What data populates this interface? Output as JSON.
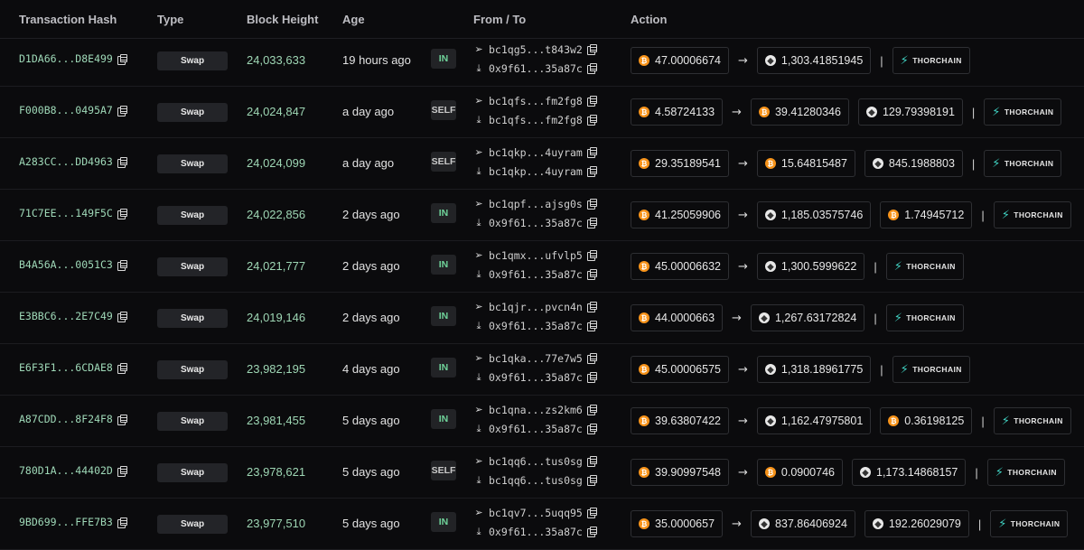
{
  "headers": {
    "hash": "Transaction Hash",
    "type": "Type",
    "block": "Block Height",
    "age": "Age",
    "fromto": "From / To",
    "action": "Action"
  },
  "rows": [
    {
      "hash": "D1DA66...D8E499",
      "type": "Swap",
      "block": "24,033,633",
      "age": "19 hours ago",
      "dir": "IN",
      "from": "bc1qg5...t843w2",
      "to": "0x9f61...35a87c",
      "action": [
        {
          "kind": "asset",
          "coin": "btc",
          "amount": "47.00006674"
        },
        {
          "kind": "arrow"
        },
        {
          "kind": "asset",
          "coin": "eth",
          "amount": "1,303.41851945"
        },
        {
          "kind": "sep"
        },
        {
          "kind": "thor",
          "label": "THORCHAIN"
        }
      ]
    },
    {
      "hash": "F000B8...0495A7",
      "type": "Swap",
      "block": "24,024,847",
      "age": "a day ago",
      "dir": "SELF",
      "from": "bc1qfs...fm2fg8",
      "to": "bc1qfs...fm2fg8",
      "action": [
        {
          "kind": "asset",
          "coin": "btc",
          "amount": "4.58724133"
        },
        {
          "kind": "arrow"
        },
        {
          "kind": "asset",
          "coin": "btc",
          "amount": "39.41280346"
        },
        {
          "kind": "asset",
          "coin": "eth",
          "amount": "129.79398191"
        },
        {
          "kind": "sep"
        },
        {
          "kind": "thor",
          "label": "THORCHAIN"
        }
      ]
    },
    {
      "hash": "A283CC...DD4963",
      "type": "Swap",
      "block": "24,024,099",
      "age": "a day ago",
      "dir": "SELF",
      "from": "bc1qkp...4uyram",
      "to": "bc1qkp...4uyram",
      "action": [
        {
          "kind": "asset",
          "coin": "btc",
          "amount": "29.35189541"
        },
        {
          "kind": "arrow"
        },
        {
          "kind": "asset",
          "coin": "btc",
          "amount": "15.64815487"
        },
        {
          "kind": "asset",
          "coin": "eth",
          "amount": "845.1988803"
        },
        {
          "kind": "sep"
        },
        {
          "kind": "thor",
          "label": "THORCHAIN"
        }
      ]
    },
    {
      "hash": "71C7EE...149F5C",
      "type": "Swap",
      "block": "24,022,856",
      "age": "2 days ago",
      "dir": "IN",
      "from": "bc1qpf...ajsg0s",
      "to": "0x9f61...35a87c",
      "action": [
        {
          "kind": "asset",
          "coin": "btc",
          "amount": "41.25059906"
        },
        {
          "kind": "arrow"
        },
        {
          "kind": "asset",
          "coin": "eth",
          "amount": "1,185.03575746"
        },
        {
          "kind": "asset",
          "coin": "btc",
          "amount": "1.74945712"
        },
        {
          "kind": "sep"
        },
        {
          "kind": "thor",
          "label": "THORCHAIN"
        }
      ]
    },
    {
      "hash": "B4A56A...0051C3",
      "type": "Swap",
      "block": "24,021,777",
      "age": "2 days ago",
      "dir": "IN",
      "from": "bc1qmx...ufvlp5",
      "to": "0x9f61...35a87c",
      "action": [
        {
          "kind": "asset",
          "coin": "btc",
          "amount": "45.00006632"
        },
        {
          "kind": "arrow"
        },
        {
          "kind": "asset",
          "coin": "eth",
          "amount": "1,300.5999622"
        },
        {
          "kind": "sep"
        },
        {
          "kind": "thor",
          "label": "THORCHAIN"
        }
      ]
    },
    {
      "hash": "E3BBC6...2E7C49",
      "type": "Swap",
      "block": "24,019,146",
      "age": "2 days ago",
      "dir": "IN",
      "from": "bc1qjr...pvcn4n",
      "to": "0x9f61...35a87c",
      "action": [
        {
          "kind": "asset",
          "coin": "btc",
          "amount": "44.0000663"
        },
        {
          "kind": "arrow"
        },
        {
          "kind": "asset",
          "coin": "eth",
          "amount": "1,267.63172824"
        },
        {
          "kind": "sep"
        },
        {
          "kind": "thor",
          "label": "THORCHAIN"
        }
      ]
    },
    {
      "hash": "E6F3F1...6CDAE8",
      "type": "Swap",
      "block": "23,982,195",
      "age": "4 days ago",
      "dir": "IN",
      "from": "bc1qka...77e7w5",
      "to": "0x9f61...35a87c",
      "action": [
        {
          "kind": "asset",
          "coin": "btc",
          "amount": "45.00006575"
        },
        {
          "kind": "arrow"
        },
        {
          "kind": "asset",
          "coin": "eth",
          "amount": "1,318.18961775"
        },
        {
          "kind": "sep"
        },
        {
          "kind": "thor",
          "label": "THORCHAIN"
        }
      ]
    },
    {
      "hash": "A87CDD...8F24F8",
      "type": "Swap",
      "block": "23,981,455",
      "age": "5 days ago",
      "dir": "IN",
      "from": "bc1qna...zs2km6",
      "to": "0x9f61...35a87c",
      "action": [
        {
          "kind": "asset",
          "coin": "btc",
          "amount": "39.63807422"
        },
        {
          "kind": "arrow"
        },
        {
          "kind": "asset",
          "coin": "eth",
          "amount": "1,162.47975801"
        },
        {
          "kind": "asset",
          "coin": "btc",
          "amount": "0.36198125"
        },
        {
          "kind": "sep"
        },
        {
          "kind": "thor",
          "label": "THORCHAIN"
        }
      ]
    },
    {
      "hash": "780D1A...44402D",
      "type": "Swap",
      "block": "23,978,621",
      "age": "5 days ago",
      "dir": "SELF",
      "from": "bc1qq6...tus0sg",
      "to": "bc1qq6...tus0sg",
      "action": [
        {
          "kind": "asset",
          "coin": "btc",
          "amount": "39.90997548"
        },
        {
          "kind": "arrow"
        },
        {
          "kind": "asset",
          "coin": "btc",
          "amount": "0.0900746"
        },
        {
          "kind": "asset",
          "coin": "eth",
          "amount": "1,173.14868157"
        },
        {
          "kind": "sep"
        },
        {
          "kind": "thor",
          "label": "THORCHAIN"
        }
      ]
    },
    {
      "hash": "9BD699...FFE7B3",
      "type": "Swap",
      "block": "23,977,510",
      "age": "5 days ago",
      "dir": "IN",
      "from": "bc1qv7...5uqq95",
      "to": "0x9f61...35a87c",
      "action": [
        {
          "kind": "asset",
          "coin": "btc",
          "amount": "35.0000657"
        },
        {
          "kind": "arrow"
        },
        {
          "kind": "asset",
          "coin": "eth",
          "amount": "837.86406924"
        },
        {
          "kind": "asset",
          "coin": "eth",
          "amount": "192.26029079"
        },
        {
          "kind": "sep"
        },
        {
          "kind": "thor",
          "label": "THORCHAIN"
        }
      ]
    }
  ],
  "icons": {
    "btc_glyph": "₿",
    "eth_glyph": "◆",
    "arrow_glyph": "→",
    "sep_glyph": "|",
    "thor_glyph": "⚡",
    "from_glyph": "➢",
    "to_glyph": "⤓"
  },
  "colors": {
    "btc": "#f7931a",
    "in_badge": "#6fd39a",
    "hash_text": "#9fd9b8",
    "thorchain_accent": "#3fd0c0"
  }
}
